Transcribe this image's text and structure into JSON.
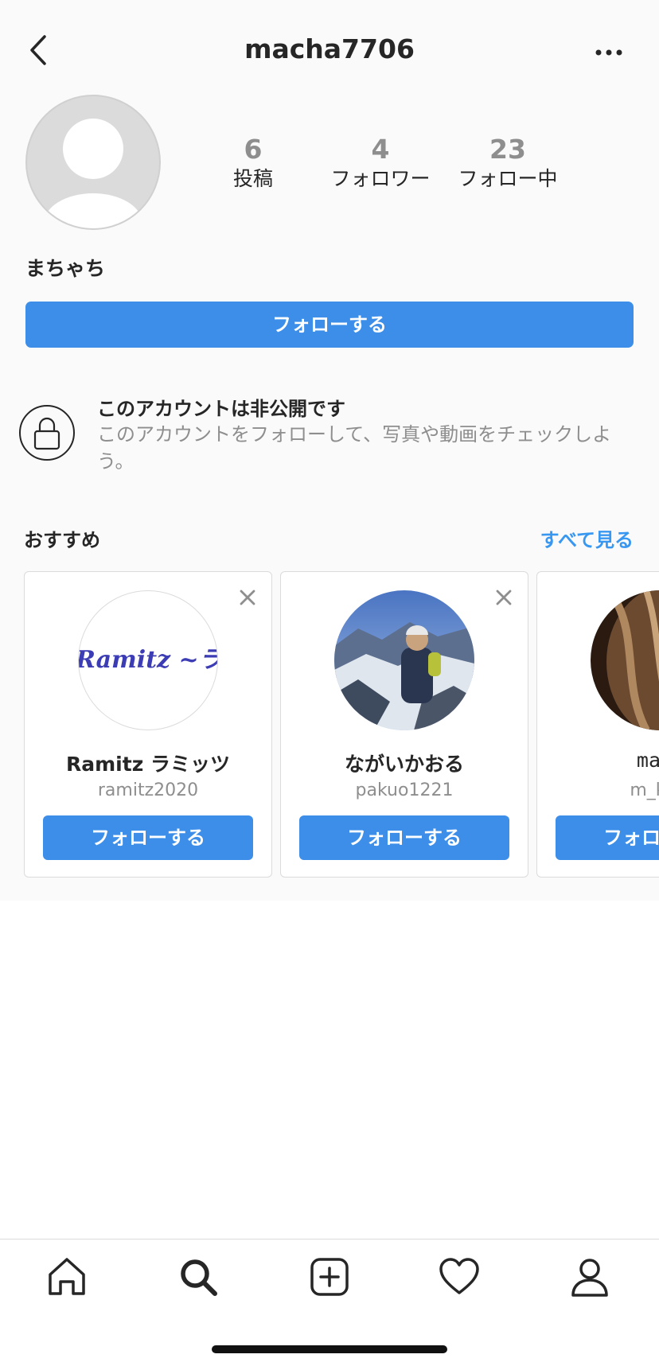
{
  "header": {
    "username": "macha7706"
  },
  "stats": [
    {
      "count": "6",
      "label": "投稿"
    },
    {
      "count": "4",
      "label": "フォロワー"
    },
    {
      "count": "23",
      "label": "フォロー中"
    }
  ],
  "profile": {
    "display_name": "まちゃち",
    "follow_label": "フォローする"
  },
  "private_notice": {
    "title": "このアカウントは非公開です",
    "description": "このアカウントをフォローして、写真や動画をチェックしよう。"
  },
  "suggestions": {
    "title": "おすすめ",
    "see_all": "すべて見る",
    "logo_text": "Ramitz ~ラミッツ~",
    "cards": [
      {
        "name": "Ramitz ラミッツ",
        "handle": "ramitz2020",
        "follow_label": "フォローする"
      },
      {
        "name": "ながいかおる",
        "handle": "pakuo1221",
        "follow_label": "フォローする"
      },
      {
        "name": "mari",
        "handle": "m_kich",
        "follow_label": "フォローする"
      }
    ]
  },
  "colors": {
    "primary": "#3c8ee9",
    "link": "#3897f0",
    "text": "#262626",
    "secondary_text": "#8e8e8e"
  },
  "tabbar": [
    "home-icon",
    "search-icon",
    "new-post-icon",
    "activity-heart-icon",
    "profile-icon"
  ]
}
